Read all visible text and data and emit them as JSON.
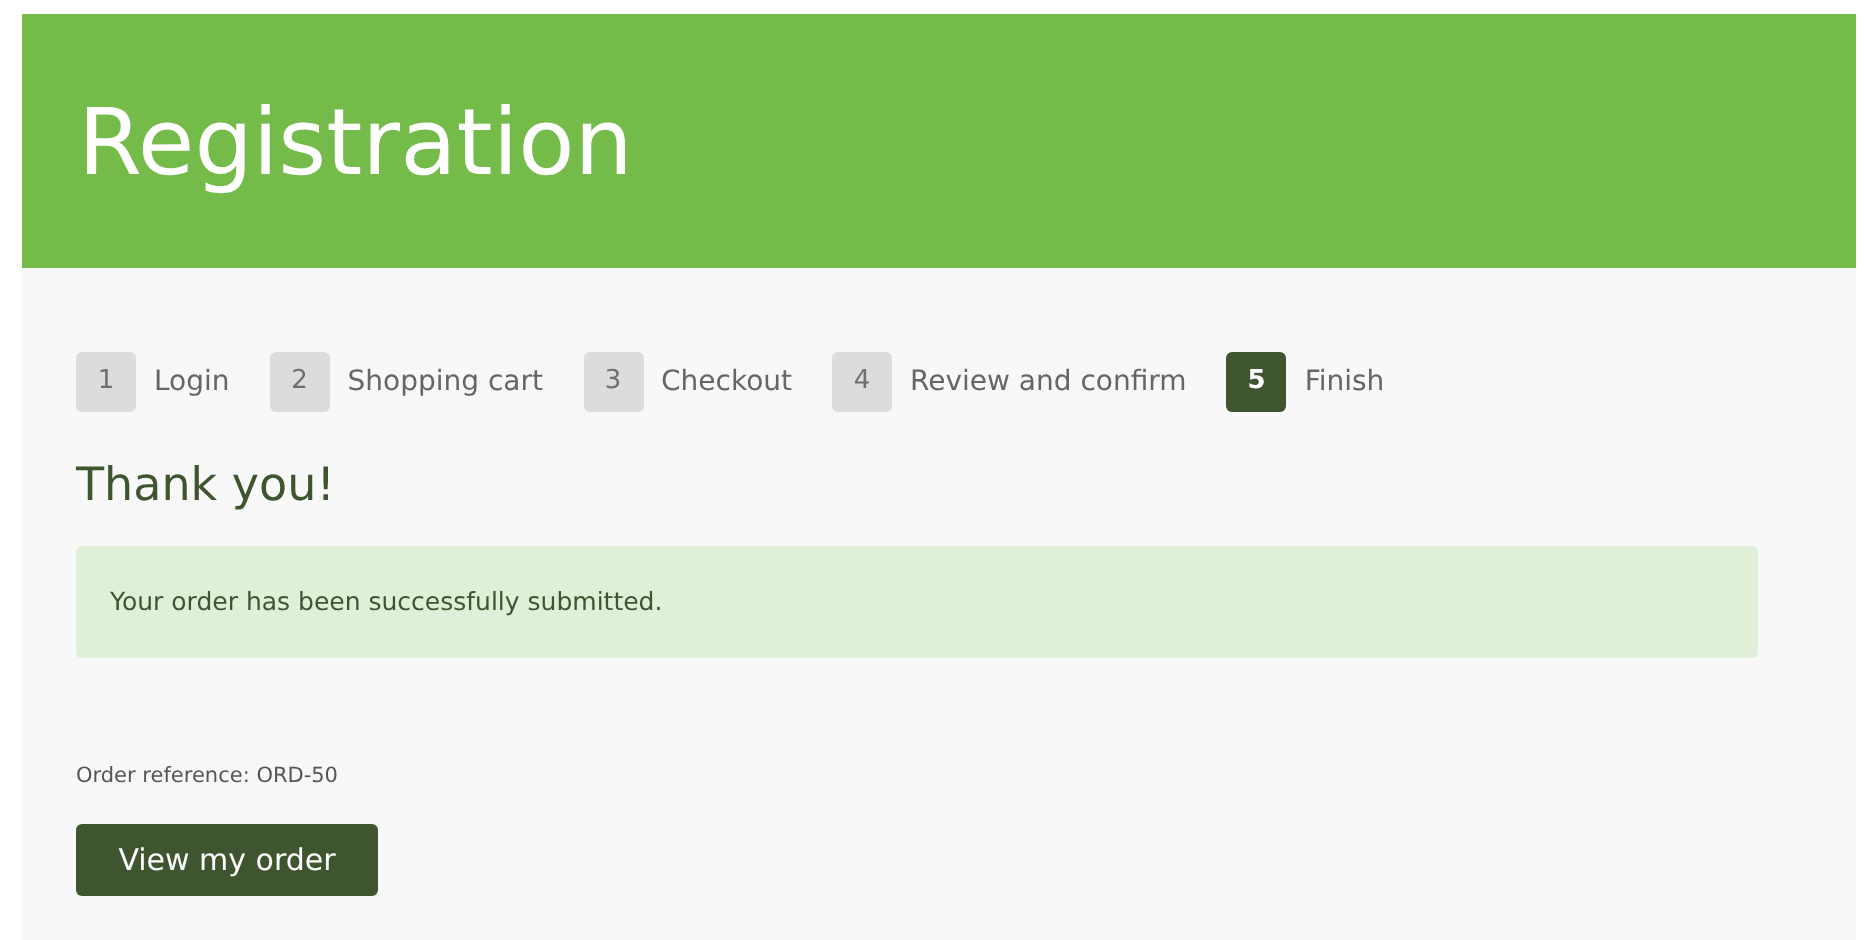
{
  "header": {
    "title": "Registration"
  },
  "steps": [
    {
      "number": "1",
      "label": "Login",
      "selected": false
    },
    {
      "number": "2",
      "label": "Shopping cart",
      "selected": false
    },
    {
      "number": "3",
      "label": "Checkout",
      "selected": false
    },
    {
      "number": "4",
      "label": "Review and confirm",
      "selected": false
    },
    {
      "number": "5",
      "label": "Finish",
      "selected": true
    }
  ],
  "heading": "Thank you!",
  "alert": "Your order has been successfully submitted.",
  "order_reference": "Order reference: ORD-50",
  "button": "View my order"
}
